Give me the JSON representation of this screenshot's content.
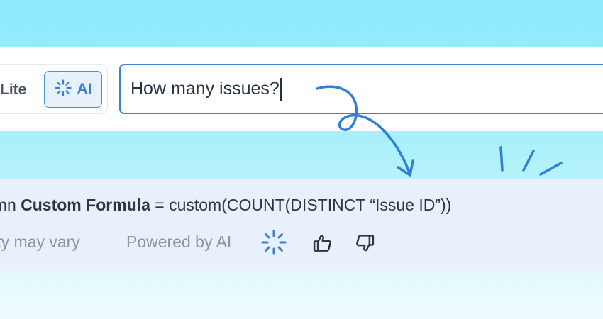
{
  "mode_toggle": {
    "lite_label": "Lite",
    "ai_label": "AI",
    "ai_icon": "sparkle-icon",
    "active": "AI"
  },
  "query": {
    "value": "How many issues?"
  },
  "result": {
    "formula_prefix": "umn ",
    "formula_name": "Custom Formula",
    "formula_expression": " = custom(COUNT(DISTINCT “Issue ID”))",
    "disclaimer": "lity may vary",
    "powered_by": "Powered by AI",
    "thumbs_up_icon": "thumbs-up-icon",
    "thumbs_down_icon": "thumbs-down-icon"
  },
  "colors": {
    "accent": "#3f82d1",
    "background_top": "#8de9fd",
    "result_panel": "#e7f0fb"
  }
}
